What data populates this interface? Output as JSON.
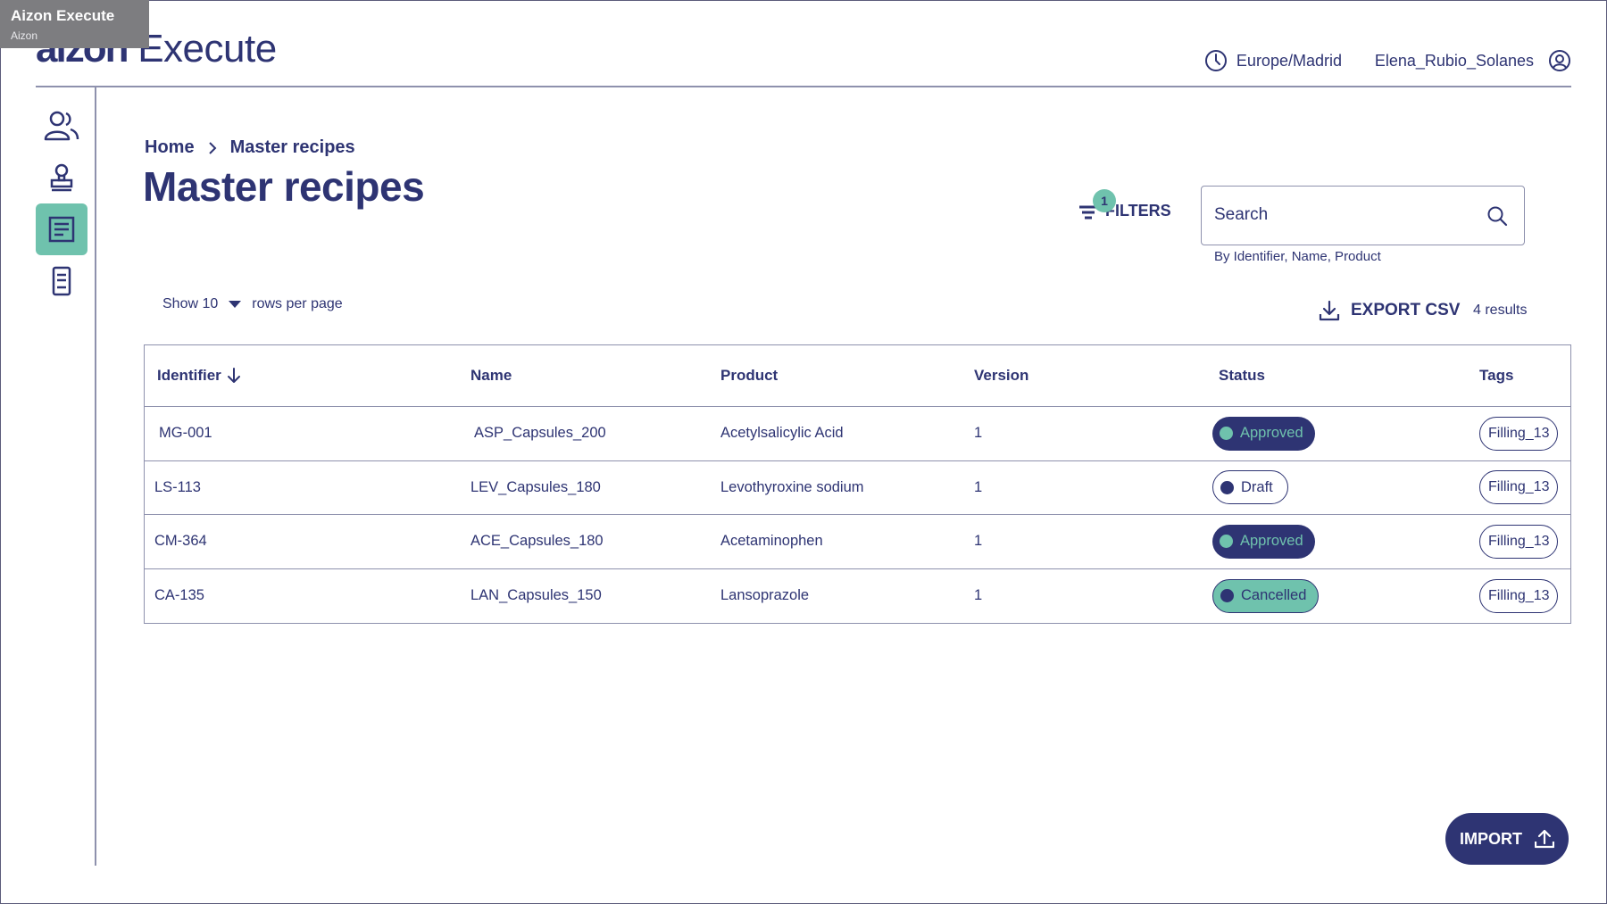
{
  "window": {
    "title": "Aizon Execute",
    "subtitle": "Aizon"
  },
  "header": {
    "logo_brand": "aizon",
    "logo_product": "Execute",
    "timezone": "Europe/Madrid",
    "username": "Elena_Rubio_Solanes"
  },
  "sidebar": {
    "items": [
      {
        "icon": "users-icon",
        "active": false
      },
      {
        "icon": "stamp-icon",
        "active": false
      },
      {
        "icon": "document-list-icon",
        "active": true
      },
      {
        "icon": "device-icon",
        "active": false
      }
    ]
  },
  "breadcrumb": {
    "home": "Home",
    "current": "Master recipes"
  },
  "page_title": "Master recipes",
  "filters": {
    "label": "FILTERS",
    "count": "1"
  },
  "search": {
    "placeholder": "Search",
    "hint": "By Identifier, Name, Product"
  },
  "pagination": {
    "show_label": "Show 10",
    "suffix": "rows per page"
  },
  "export": {
    "label": "EXPORT CSV"
  },
  "results": "4 results",
  "table": {
    "columns": [
      "Identifier",
      "Name",
      "Product",
      "Version",
      "Status",
      "Tags"
    ],
    "rows": [
      {
        "id": "MG-001",
        "name": "ASP_Capsules_200",
        "product": "Acetylsalicylic Acid",
        "version": "1",
        "status": "Approved",
        "tag": "Filling_13"
      },
      {
        "id": "LS-113",
        "name": "LEV_Capsules_180",
        "product": "Levothyroxine sodium",
        "version": "1",
        "status": "Draft",
        "tag": "Filling_13"
      },
      {
        "id": "CM-364",
        "name": "ACE_Capsules_180",
        "product": "Acetaminophen",
        "version": "1",
        "status": "Approved",
        "tag": "Filling_13"
      },
      {
        "id": "CA-135",
        "name": "LAN_Capsules_150",
        "product": "Lansoprazole",
        "version": "1",
        "status": "Cancelled",
        "tag": "Filling_13"
      }
    ]
  },
  "import": {
    "label": "IMPORT"
  },
  "colors": {
    "primary": "#2e3473",
    "accent": "#6fc2ad",
    "border": "#8e91ad"
  }
}
